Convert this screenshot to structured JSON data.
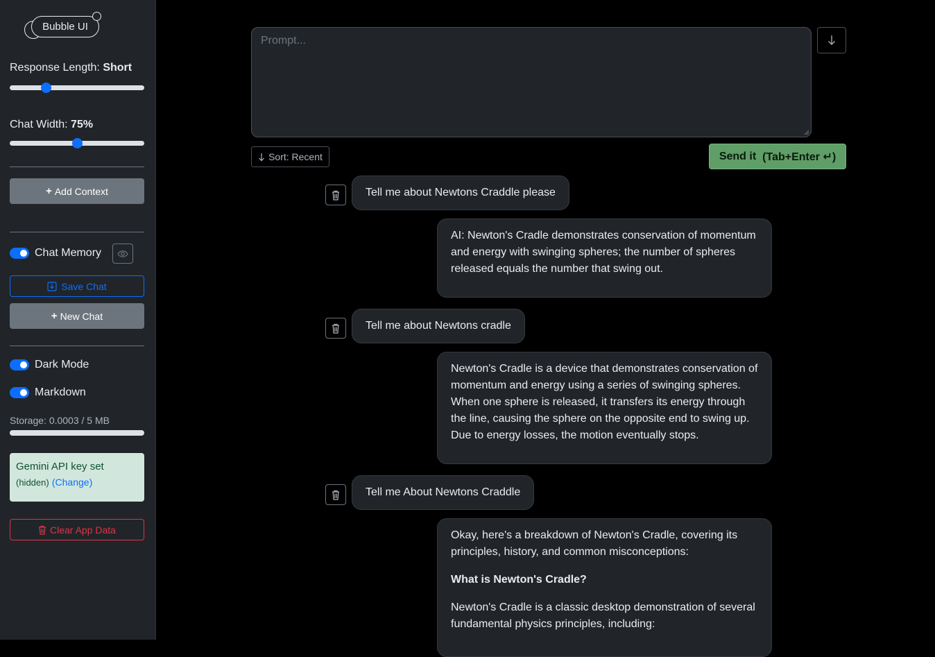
{
  "app": {
    "logo_text": "Bubble UI"
  },
  "sidebar": {
    "response_length": {
      "label": "Response Length:",
      "value": "Short",
      "level": 0.25
    },
    "chat_width": {
      "label": "Chat Width:",
      "value": "75%",
      "level": 0.5
    },
    "add_context_label": "Add Context",
    "chat_memory_label": "Chat Memory",
    "save_chat_label": "Save Chat",
    "new_chat_label": "New Chat",
    "dark_mode_label": "Dark Mode",
    "markdown_label": "Markdown",
    "storage_label": "Storage: 0.0003 / 5 MB",
    "storage_fraction": 6e-05,
    "api_key": {
      "text": "Gemini API key set",
      "hidden": "(hidden)",
      "change": "(Change)"
    },
    "clear_data_label": "Clear App Data"
  },
  "main": {
    "prompt_placeholder": "Prompt...",
    "sort_label": "Sort: Recent",
    "send_label": "Send it",
    "send_shortcut": "(Tab+Enter ↵)",
    "messages": [
      {
        "user": "Tell me about Newtons Craddle please",
        "ai": [
          "AI: Newton's Cradle demonstrates conservation of momentum and energy with swinging spheres; the number of spheres released equals the number that swing out."
        ]
      },
      {
        "user": "Tell me about Newtons cradle",
        "ai": [
          "Newton's Cradle is a device that demonstrates conservation of momentum and energy using a series of swinging spheres. When one sphere is released, it transfers its energy through the line, causing the sphere on the opposite end to swing up. Due to energy losses, the motion eventually stops."
        ]
      },
      {
        "user": "Tell me About Newtons Craddle",
        "ai": [
          "Okay, here's a breakdown of Newton's Cradle, covering its principles, history, and common misconceptions:",
          "What is Newton's Cradle?",
          "Newton's Cradle is a classic desktop demonstration of several fundamental physics principles, including:"
        ]
      }
    ]
  },
  "colors": {
    "accent": "#0d6efd",
    "send": "#5f9e67",
    "danger": "#dc3545",
    "alert_bg": "#d1e7dd"
  }
}
